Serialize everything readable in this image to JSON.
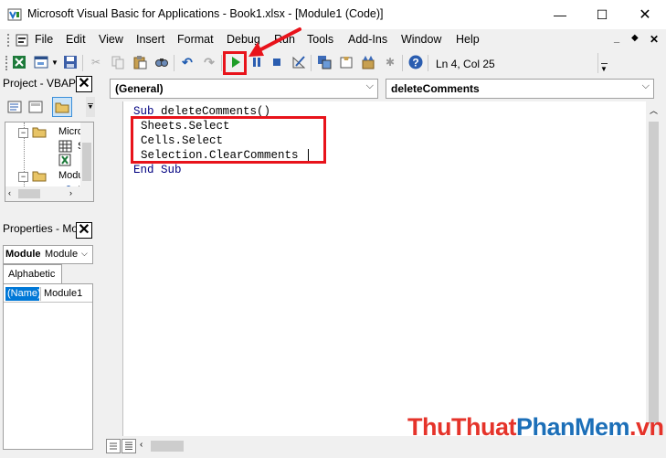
{
  "window": {
    "title": "Microsoft Visual Basic for Applications - Book1.xlsx - [Module1 (Code)]",
    "minimize": "—",
    "maximize": "☐",
    "close": "✕"
  },
  "menu": {
    "items": [
      "File",
      "Edit",
      "View",
      "Insert",
      "Format",
      "Debug",
      "Run",
      "Tools",
      "Add-Ins",
      "Window",
      "Help"
    ],
    "mdi_buttons": [
      "_",
      "◆",
      "✕"
    ]
  },
  "toolbar": {
    "status": "Ln 4, Col 25"
  },
  "project_panel": {
    "title": "Project - VBAPr",
    "tree": [
      "Micro",
      "S",
      "",
      "Modu",
      "I"
    ]
  },
  "properties_panel": {
    "title": "Properties - Mo",
    "object_name": "Module",
    "object_type": "Module",
    "tab": "Alphabetic",
    "prop_name": "(Name)",
    "prop_value": "Module1"
  },
  "code_window": {
    "object_combo": "(General)",
    "proc_combo": "deleteComments",
    "lines": {
      "l1_kw": "Sub",
      "l1_rest": " deleteComments()",
      "l2": "Sheets.Select",
      "l3": "Cells.Select",
      "l4": "Selection.ClearComments",
      "l5": "End Sub"
    }
  },
  "watermark": {
    "part1": "ThuThuat",
    "part2": "PhanMem",
    "part3": ".vn"
  },
  "colors": {
    "highlight_red": "#e8131b",
    "keyword_blue": "#000080",
    "run_green": "#1e9e28",
    "watermark_red": "#e5332a",
    "watermark_blue": "#1c6fb8"
  }
}
